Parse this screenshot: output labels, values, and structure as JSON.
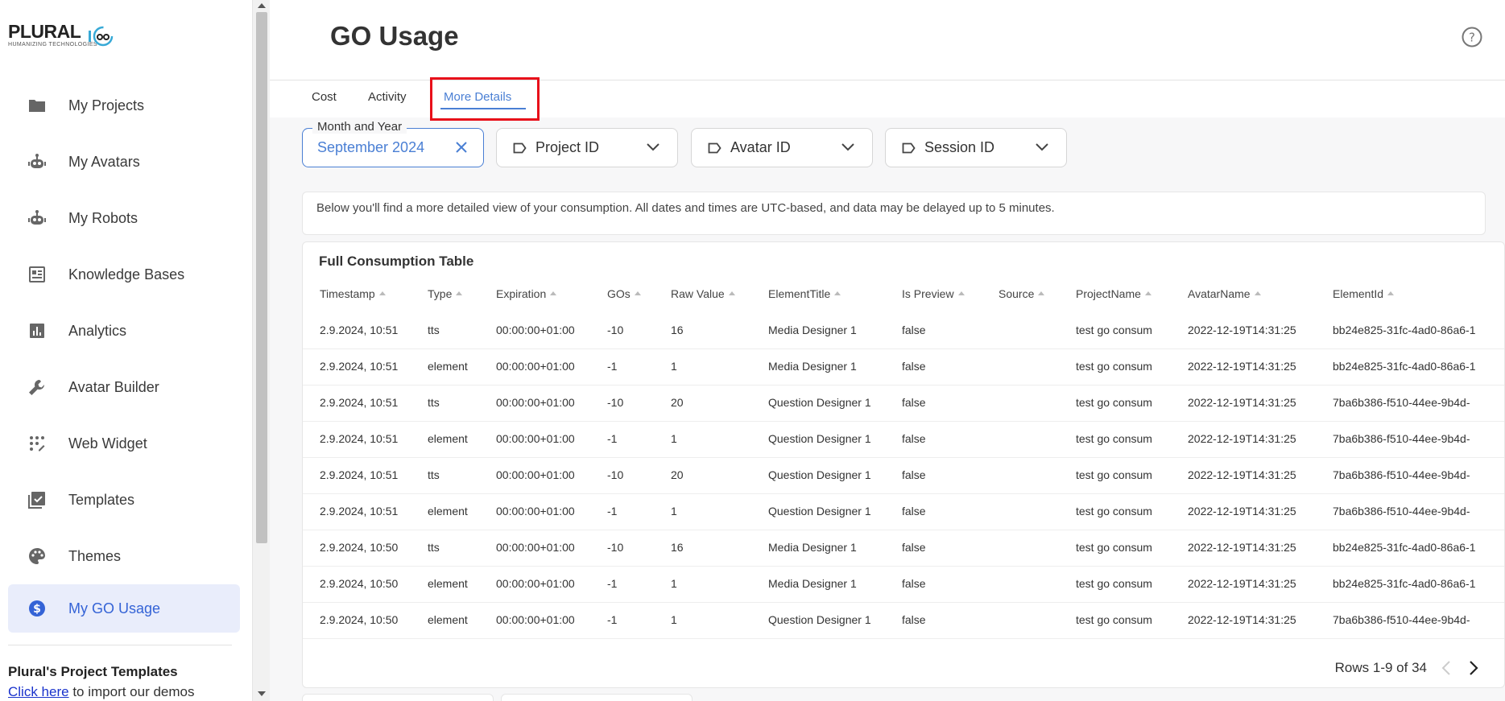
{
  "brand": {
    "name": "PLURAL",
    "tagline": "HUMANIZING TECHNOLOGIES"
  },
  "sidebar": {
    "items": [
      {
        "label": "My Projects",
        "icon": "folder-icon"
      },
      {
        "label": "My Avatars",
        "icon": "robot-icon"
      },
      {
        "label": "My Robots",
        "icon": "robot-icon"
      },
      {
        "label": "Knowledge Bases",
        "icon": "knowledge-base-icon"
      },
      {
        "label": "Analytics",
        "icon": "analytics-icon"
      },
      {
        "label": "Avatar Builder",
        "icon": "wrench-icon"
      },
      {
        "label": "Web Widget",
        "icon": "widget-icon"
      },
      {
        "label": "Templates",
        "icon": "templates-icon"
      },
      {
        "label": "Themes",
        "icon": "palette-icon"
      },
      {
        "label": "My GO Usage",
        "icon": "dollar-icon",
        "active": true
      }
    ],
    "promo": {
      "title": "Plural's Project Templates",
      "link_text": "Click here",
      "rest_text": " to import our demos"
    }
  },
  "header": {
    "title": "GO Usage"
  },
  "tabs": [
    {
      "label": "Cost"
    },
    {
      "label": "Activity"
    },
    {
      "label": "More Details",
      "active": true
    }
  ],
  "filters": {
    "month_year": {
      "legend": "Month and Year",
      "value": "September 2024"
    },
    "project_id": {
      "label": "Project ID"
    },
    "avatar_id": {
      "label": "Avatar ID"
    },
    "session_id": {
      "label": "Session ID"
    }
  },
  "info_text": "Below you'll find a more detailed view of your consumption. All dates and times are UTC-based, and data may be delayed up to 5 minutes.",
  "table": {
    "title": "Full Consumption Table",
    "columns": [
      "Timestamp",
      "Type",
      "Expiration",
      "GOs",
      "Raw Value",
      "ElementTitle",
      "Is Preview",
      "Source",
      "ProjectName",
      "AvatarName",
      "ElementId"
    ],
    "rows": [
      [
        "2.9.2024, 10:51",
        "tts",
        "00:00:00+01:00",
        "-10",
        "16",
        "Media Designer 1",
        "false",
        "",
        "test go consum",
        "2022-12-19T14:31:25",
        "bb24e825-31fc-4ad0-86a6-1"
      ],
      [
        "2.9.2024, 10:51",
        "element",
        "00:00:00+01:00",
        "-1",
        "1",
        "Media Designer 1",
        "false",
        "",
        "test go consum",
        "2022-12-19T14:31:25",
        "bb24e825-31fc-4ad0-86a6-1"
      ],
      [
        "2.9.2024, 10:51",
        "tts",
        "00:00:00+01:00",
        "-10",
        "20",
        "Question Designer 1",
        "false",
        "",
        "test go consum",
        "2022-12-19T14:31:25",
        "7ba6b386-f510-44ee-9b4d-"
      ],
      [
        "2.9.2024, 10:51",
        "element",
        "00:00:00+01:00",
        "-1",
        "1",
        "Question Designer 1",
        "false",
        "",
        "test go consum",
        "2022-12-19T14:31:25",
        "7ba6b386-f510-44ee-9b4d-"
      ],
      [
        "2.9.2024, 10:51",
        "tts",
        "00:00:00+01:00",
        "-10",
        "20",
        "Question Designer 1",
        "false",
        "",
        "test go consum",
        "2022-12-19T14:31:25",
        "7ba6b386-f510-44ee-9b4d-"
      ],
      [
        "2.9.2024, 10:51",
        "element",
        "00:00:00+01:00",
        "-1",
        "1",
        "Question Designer 1",
        "false",
        "",
        "test go consum",
        "2022-12-19T14:31:25",
        "7ba6b386-f510-44ee-9b4d-"
      ],
      [
        "2.9.2024, 10:50",
        "tts",
        "00:00:00+01:00",
        "-10",
        "16",
        "Media Designer 1",
        "false",
        "",
        "test go consum",
        "2022-12-19T14:31:25",
        "bb24e825-31fc-4ad0-86a6-1"
      ],
      [
        "2.9.2024, 10:50",
        "element",
        "00:00:00+01:00",
        "-1",
        "1",
        "Media Designer 1",
        "false",
        "",
        "test go consum",
        "2022-12-19T14:31:25",
        "bb24e825-31fc-4ad0-86a6-1"
      ],
      [
        "2.9.2024, 10:50",
        "element",
        "00:00:00+01:00",
        "-1",
        "1",
        "Question Designer 1",
        "false",
        "",
        "test go consum",
        "2022-12-19T14:31:25",
        "7ba6b386-f510-44ee-9b4d-"
      ]
    ],
    "pagination": {
      "text": "Rows 1-9 of 34"
    }
  },
  "colors": {
    "accent": "#4a7fd4",
    "active_nav_bg": "#e9edfb",
    "active_nav_text": "#3463d6",
    "highlight": "#e8101a"
  }
}
